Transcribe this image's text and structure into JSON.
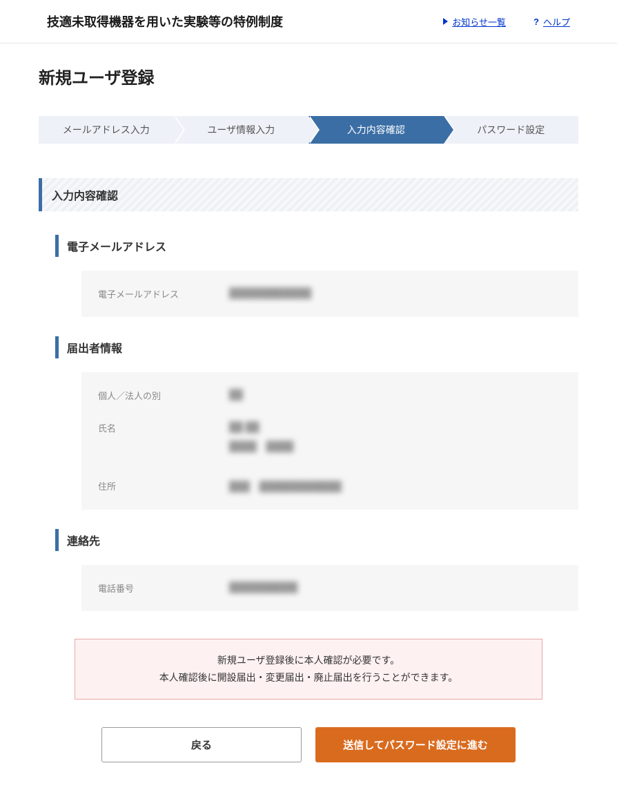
{
  "header": {
    "title": "技適未取得機器を用いた実験等の特例制度",
    "news_link": "お知らせ一覧",
    "help_link": "ヘルプ"
  },
  "page_title": "新規ユーザ登録",
  "stepper": [
    {
      "label": "メールアドレス入力"
    },
    {
      "label": "ユーザ情報入力"
    },
    {
      "label": "入力内容確認"
    },
    {
      "label": "パスワード設定"
    }
  ],
  "section_title": "入力内容確認",
  "email_section": {
    "title": "電子メールアドレス",
    "label": "電子メールアドレス",
    "value": "████████████"
  },
  "applicant_section": {
    "title": "届出者情報",
    "rows": [
      {
        "label": "個人／法人の別",
        "value": "██"
      },
      {
        "label": "氏名",
        "value": "██ ██",
        "value2": "████　████"
      },
      {
        "label": "住所",
        "value": "███　████████████"
      }
    ]
  },
  "contact_section": {
    "title": "連絡先",
    "label": "電話番号",
    "value": "██████████"
  },
  "notice": {
    "line1": "新規ユーザ登録後に本人確認が必要です。",
    "line2": "本人確認後に開設届出・変更届出・廃止届出を行うことができます。"
  },
  "buttons": {
    "back": "戻る",
    "next": "送信してパスワード設定に進む"
  }
}
